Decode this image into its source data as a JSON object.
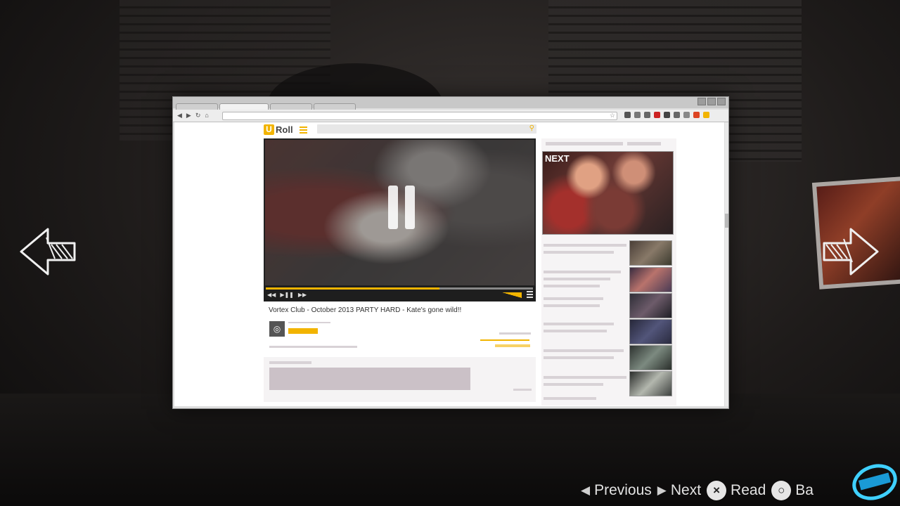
{
  "browser": {
    "tabs": [
      "",
      "",
      "",
      ""
    ],
    "address": ""
  },
  "site": {
    "logo_letter": "U",
    "logo_text": "Roll",
    "next_label": "NEXT"
  },
  "video": {
    "title": "Vortex Club - October 2013 PARTY HARD - Kate's gone wild!!",
    "progress": 0.65,
    "state": "paused"
  },
  "prompts": {
    "previous_label": "Previous",
    "next_label": "Next",
    "read_label": "Read",
    "back_label": "Ba"
  },
  "colors": {
    "accent": "#f2b400",
    "prompt_text": "#e3e3e3"
  },
  "icons": {
    "pause": "pause-icon",
    "search": "search-icon",
    "menu": "menu-icon",
    "cross_button": "×",
    "circle_button": "○"
  }
}
